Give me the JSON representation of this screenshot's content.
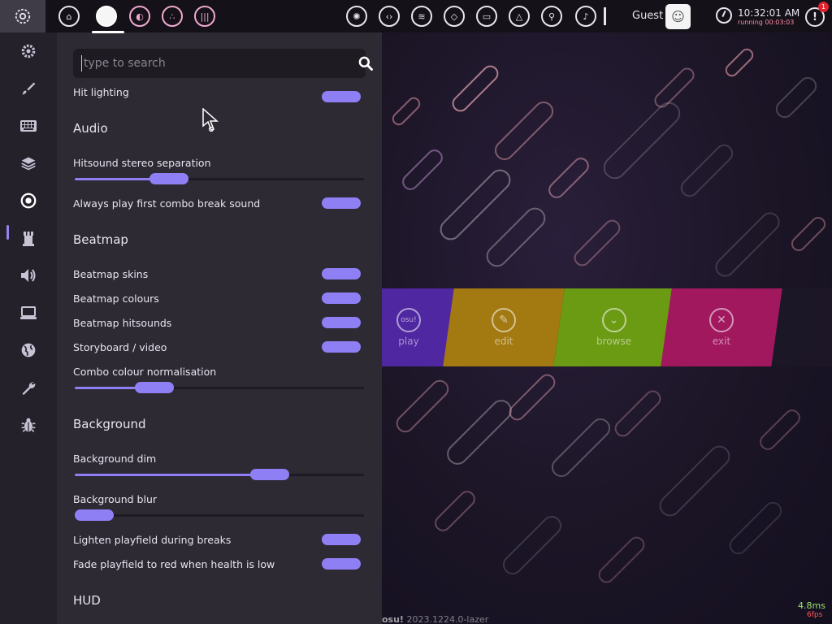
{
  "toolbar": {
    "user_name": "Guest",
    "clock_time": "10:32:01 AM",
    "clock_running": "running 00:03:03",
    "notification_count": "1",
    "rulesets": [
      "osu",
      "taiko",
      "catch",
      "mania"
    ],
    "overlay_icons": [
      "news",
      "changelog",
      "rankings",
      "beatmap-listing",
      "chat",
      "dashboard",
      "wiki",
      "now-playing"
    ]
  },
  "sidebar": {
    "items": [
      "general",
      "skin",
      "input",
      "user-interface",
      "gameplay",
      "rulesets",
      "audio",
      "graphics",
      "online",
      "maintenance",
      "debug"
    ],
    "active": "gameplay"
  },
  "search": {
    "placeholder": "type to search",
    "value": ""
  },
  "settings": {
    "top_partial_label": "Hit lighting",
    "audio": {
      "title": "Audio",
      "stereo_label": "Hitsound stereo separation",
      "stereo_value": 0.3,
      "combo_break_label": "Always play first combo break sound"
    },
    "beatmap": {
      "title": "Beatmap",
      "skins_label": "Beatmap skins",
      "colours_label": "Beatmap colours",
      "hitsounds_label": "Beatmap hitsounds",
      "storyboard_label": "Storyboard / video",
      "combo_norm_label": "Combo colour normalisation",
      "combo_norm_value": 0.24
    },
    "background": {
      "title": "Background",
      "dim_label": "Background dim",
      "dim_value": 0.7,
      "blur_label": "Background blur",
      "blur_value": 0,
      "lighten_label": "Lighten playfield during breaks",
      "fade_label": "Fade playfield to red when health is low"
    },
    "hud": {
      "title": "HUD"
    }
  },
  "main_menu": {
    "buttons": [
      {
        "label": "play",
        "icon": "osu!",
        "color": "#4f27a0"
      },
      {
        "label": "edit",
        "icon": "pencil",
        "color": "#a37a11"
      },
      {
        "label": "browse",
        "icon": "double-chevron-down",
        "color": "#6b9a13"
      },
      {
        "label": "exit",
        "icon": "close",
        "color": "#a1185f"
      }
    ]
  },
  "footer": {
    "brand": "osu!",
    "version": "2023.1224.0-lazer",
    "frame_time": "4.8ms",
    "fps": "6fps"
  },
  "colors": {
    "accent": "#8f7ff5",
    "panel_bg": "#2e2a34",
    "sidebar_bg": "#25212b"
  }
}
